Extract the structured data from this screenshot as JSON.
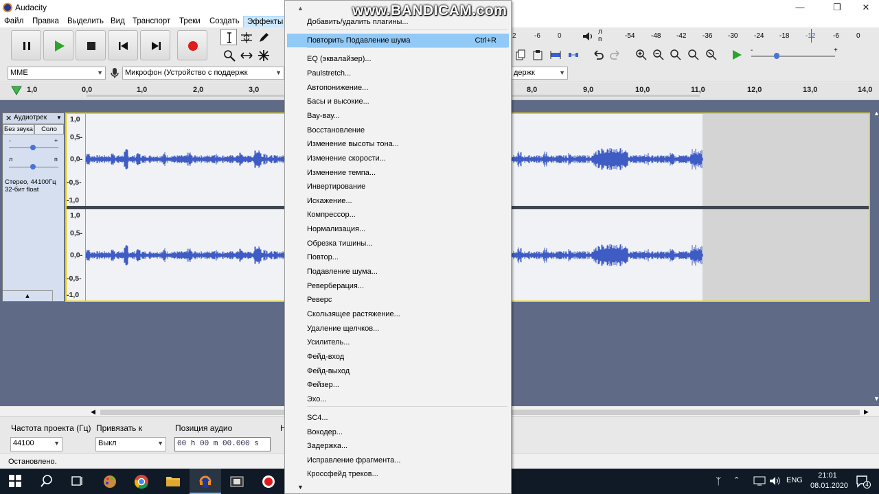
{
  "window": {
    "title": "Audacity"
  },
  "watermark": "www.BANDICAM.com",
  "menubar": {
    "items": [
      "Файл",
      "Правка",
      "Выделить",
      "Вид",
      "Транспорт",
      "Треки",
      "Создать",
      "Эффекты"
    ]
  },
  "host": {
    "label": "MME",
    "mic_device": "Микрофон (Устройство с поддержк",
    "playback_device": "держк"
  },
  "meter": {
    "ticks": [
      "-54",
      "-48",
      "-42",
      "-36",
      "-30",
      "-24",
      "-18",
      "-12",
      "-6",
      "0"
    ],
    "left_ticks": [
      "2",
      "-6",
      "0"
    ],
    "channel_l": "л",
    "channel_r": "п"
  },
  "timeline": {
    "start": "1,0",
    "ticks": [
      "0,0",
      "1,0",
      "2,0",
      "3,0",
      "8,0",
      "9,0",
      "10,0",
      "11,0",
      "12,0",
      "13,0",
      "14,0"
    ]
  },
  "track": {
    "name": "Аудиотрек",
    "mute": "Без звука",
    "solo": "Соло",
    "gain_minus": "-",
    "gain_plus": "+",
    "pan_left": "л",
    "pan_right": "п",
    "info_line1": "Стерео, 44100Гц",
    "info_line2": "32-бит float",
    "scale": [
      "1,0",
      "0,5-",
      "0,0-",
      "-0,5-",
      "-1,0"
    ]
  },
  "effects_menu": {
    "items": [
      {
        "label": "Добавить/удалить плагины...",
        "shortcut": ""
      },
      {
        "label": "Повторить Подавление шума",
        "shortcut": "Ctrl+R",
        "highlighted": true
      },
      {
        "label": "EQ (эквалайзер)...",
        "shortcut": ""
      },
      {
        "label": "Paulstretch...",
        "shortcut": ""
      },
      {
        "label": "Автопонижение...",
        "shortcut": ""
      },
      {
        "label": "Басы и высокие...",
        "shortcut": ""
      },
      {
        "label": "Вау-вау...",
        "shortcut": ""
      },
      {
        "label": "Восстановление",
        "shortcut": ""
      },
      {
        "label": "Изменение высоты тона...",
        "shortcut": ""
      },
      {
        "label": "Изменение скорости...",
        "shortcut": ""
      },
      {
        "label": "Изменение темпа...",
        "shortcut": ""
      },
      {
        "label": "Инвертирование",
        "shortcut": ""
      },
      {
        "label": "Искажение...",
        "shortcut": ""
      },
      {
        "label": "Компрессор...",
        "shortcut": ""
      },
      {
        "label": "Нормализация...",
        "shortcut": ""
      },
      {
        "label": "Обрезка тишины...",
        "shortcut": ""
      },
      {
        "label": "Повтор...",
        "shortcut": ""
      },
      {
        "label": "Подавление шума...",
        "shortcut": ""
      },
      {
        "label": "Реверберация...",
        "shortcut": ""
      },
      {
        "label": "Реверс",
        "shortcut": ""
      },
      {
        "label": "Скользящее растяжение...",
        "shortcut": ""
      },
      {
        "label": "Удаление щелчков...",
        "shortcut": ""
      },
      {
        "label": "Усилитель...",
        "shortcut": ""
      },
      {
        "label": "Фейд-вход",
        "shortcut": ""
      },
      {
        "label": "Фейд-выход",
        "shortcut": ""
      },
      {
        "label": "Фейзер...",
        "shortcut": ""
      },
      {
        "label": "Эхо...",
        "shortcut": ""
      },
      {
        "label": "SC4...",
        "shortcut": ""
      },
      {
        "label": "Вокодер...",
        "shortcut": ""
      },
      {
        "label": "Задержка...",
        "shortcut": ""
      },
      {
        "label": "Исправление фрагмента...",
        "shortcut": ""
      },
      {
        "label": "Кроссфейд треков...",
        "shortcut": ""
      }
    ]
  },
  "selection_bar": {
    "rate_label": "Частота проекта (Гц)",
    "rate_value": "44100",
    "snap_label": "Привязать к",
    "snap_value": "Выкл",
    "pos_label": "Позиция аудио",
    "pos_value": "00 h 00 m 00.000 s",
    "cut_label": "Н"
  },
  "status": {
    "text": "Остановлено."
  },
  "taskbar": {
    "lang": "ENG",
    "time": "21:01",
    "date": "08.01.2020",
    "notifications": "4"
  }
}
